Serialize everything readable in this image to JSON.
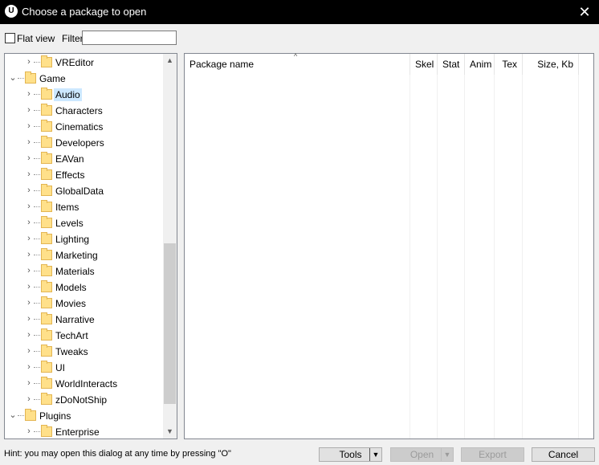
{
  "window": {
    "title": "Choose a package to open",
    "app_icon": "unreal-engine-icon",
    "close_glyph": "✕"
  },
  "toolbar": {
    "flat_view_label": "Flat view",
    "flat_view_checked": false,
    "filter_label": "Filter:",
    "filter_value": ""
  },
  "tree": {
    "items": [
      {
        "label": "VREditor",
        "level": 1,
        "expander": "›",
        "selected": false
      },
      {
        "label": "Game",
        "level": 0,
        "expander": "⌄",
        "selected": false
      },
      {
        "label": "Audio",
        "level": 1,
        "expander": "›",
        "selected": true
      },
      {
        "label": "Characters",
        "level": 1,
        "expander": "›",
        "selected": false
      },
      {
        "label": "Cinematics",
        "level": 1,
        "expander": "›",
        "selected": false
      },
      {
        "label": "Developers",
        "level": 1,
        "expander": "›",
        "selected": false
      },
      {
        "label": "EAVan",
        "level": 1,
        "expander": "›",
        "selected": false
      },
      {
        "label": "Effects",
        "level": 1,
        "expander": "›",
        "selected": false
      },
      {
        "label": "GlobalData",
        "level": 1,
        "expander": "›",
        "selected": false
      },
      {
        "label": "Items",
        "level": 1,
        "expander": "›",
        "selected": false
      },
      {
        "label": "Levels",
        "level": 1,
        "expander": "›",
        "selected": false
      },
      {
        "label": "Lighting",
        "level": 1,
        "expander": "›",
        "selected": false
      },
      {
        "label": "Marketing",
        "level": 1,
        "expander": "›",
        "selected": false
      },
      {
        "label": "Materials",
        "level": 1,
        "expander": "›",
        "selected": false
      },
      {
        "label": "Models",
        "level": 1,
        "expander": "›",
        "selected": false
      },
      {
        "label": "Movies",
        "level": 1,
        "expander": "›",
        "selected": false
      },
      {
        "label": "Narrative",
        "level": 1,
        "expander": "›",
        "selected": false
      },
      {
        "label": "TechArt",
        "level": 1,
        "expander": "›",
        "selected": false
      },
      {
        "label": "Tweaks",
        "level": 1,
        "expander": "›",
        "selected": false
      },
      {
        "label": "UI",
        "level": 1,
        "expander": "›",
        "selected": false
      },
      {
        "label": "WorldInteracts",
        "level": 1,
        "expander": "›",
        "selected": false
      },
      {
        "label": "zDoNotShip",
        "level": 1,
        "expander": "›",
        "selected": false
      },
      {
        "label": "Plugins",
        "level": 0,
        "expander": "⌄",
        "selected": false
      },
      {
        "label": "Enterprise",
        "level": 1,
        "expander": "›",
        "selected": false
      }
    ],
    "scroll_up_glyph": "▲",
    "scroll_down_glyph": "▼"
  },
  "package_list": {
    "sort_glyph": "^",
    "columns": [
      {
        "label": "Package name",
        "align": "left"
      },
      {
        "label": "Skel",
        "align": "right"
      },
      {
        "label": "Stat",
        "align": "right"
      },
      {
        "label": "Anim",
        "align": "right"
      },
      {
        "label": "Tex",
        "align": "right"
      },
      {
        "label": "Size, Kb",
        "align": "right"
      }
    ],
    "rows": []
  },
  "footer": {
    "hint": "Hint: you may open this dialog at any time by pressing \"O\"",
    "tools_label": "Tools",
    "dropdown_glyph": "▼",
    "open_label": "Open",
    "export_label": "Export",
    "cancel_label": "Cancel"
  },
  "colors": {
    "titlebar": "#000000",
    "selection": "#cce8ff",
    "folder": "#ffe08a"
  }
}
